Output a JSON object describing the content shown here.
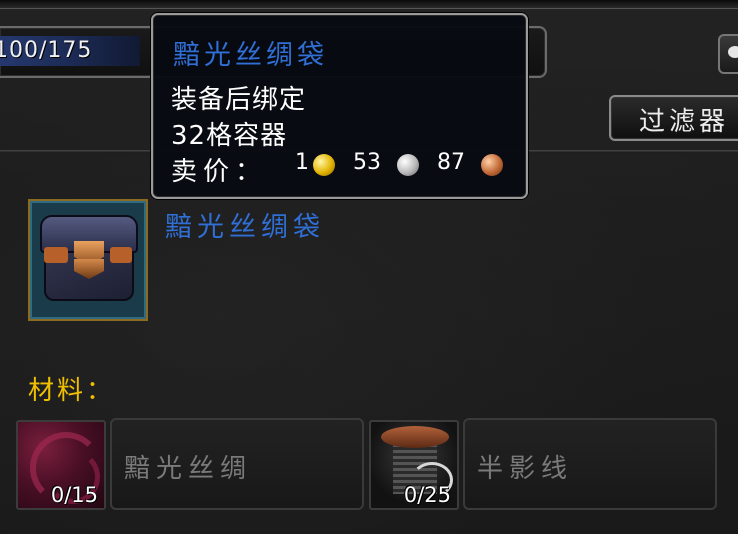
{
  "skill": {
    "value": "100/175"
  },
  "filter": {
    "label": "过滤器"
  },
  "tooltip": {
    "title": "黯光丝绸袋",
    "binding": "装备后绑定",
    "slots": "32格容器",
    "sell_label": "卖价：",
    "sell_gold": "1",
    "sell_silver": "53",
    "sell_copper": "87"
  },
  "item": {
    "name": "黯光丝绸袋",
    "icon": "bag-icon"
  },
  "materials": {
    "label": "材料：",
    "reagents": [
      {
        "name": "黯光丝绸",
        "count": "0/15",
        "icon": "cloth-icon"
      },
      {
        "name": "半影线",
        "count": "0/25",
        "icon": "thread-spool-icon"
      }
    ]
  },
  "colors": {
    "item_rare_blue": "#2f6fd6",
    "materials_gold": "#f0c000",
    "coin_gold": "#e3b400",
    "coin_silver": "#b9b9b9",
    "coin_copper": "#c26a36"
  }
}
